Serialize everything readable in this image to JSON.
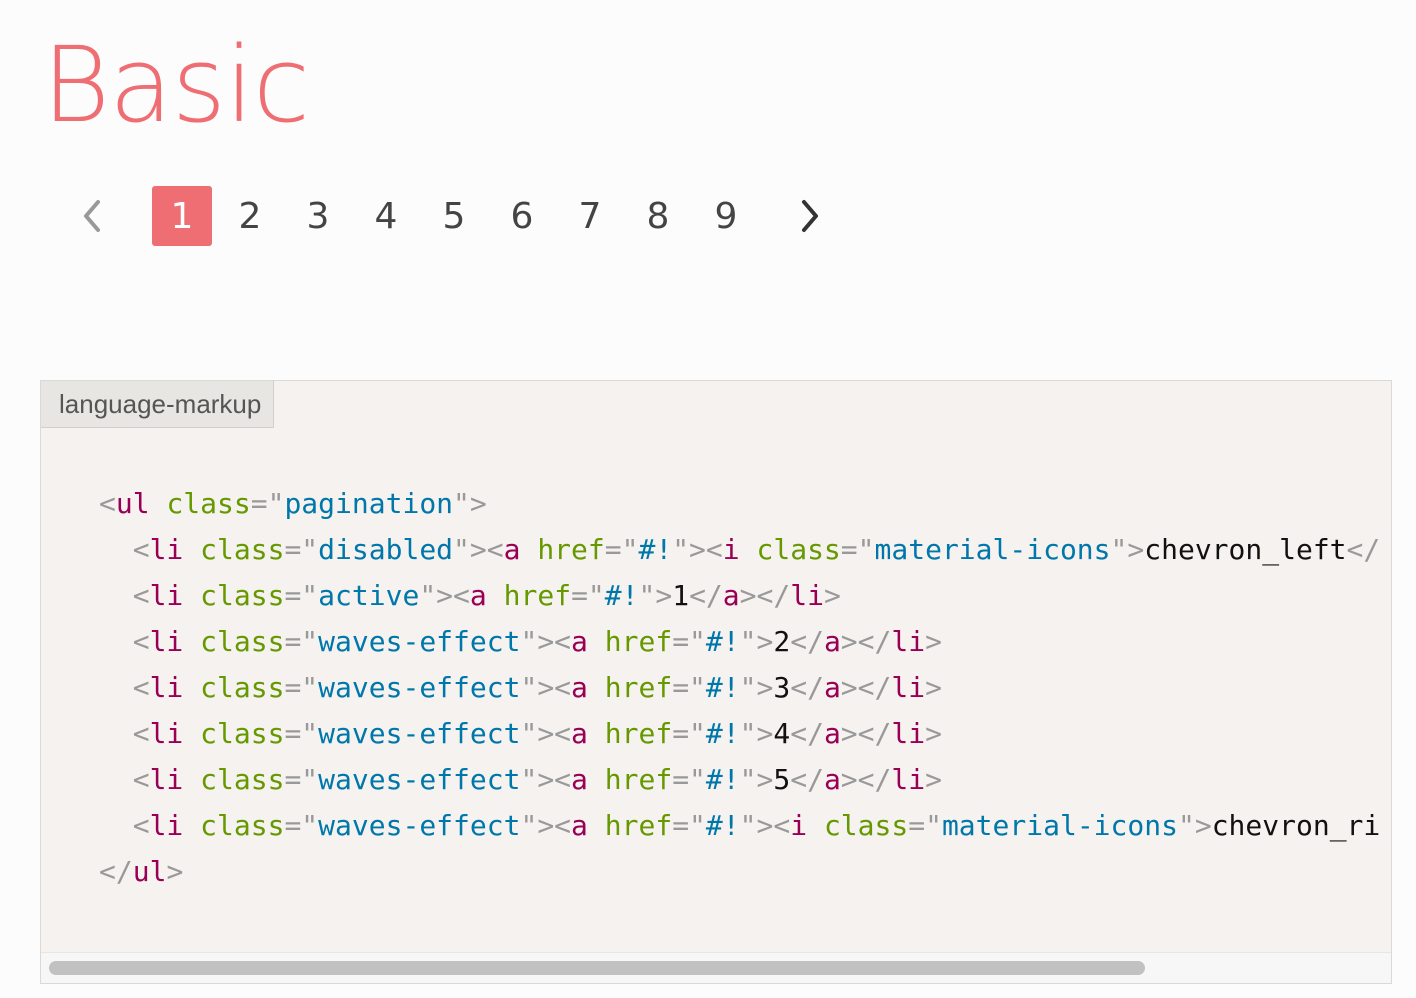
{
  "page": {
    "title": "Basic",
    "accent_color": "#ee6e73"
  },
  "pagination": {
    "prev_icon": "chevron-left-icon",
    "next_icon": "chevron-right-icon",
    "pages": [
      "1",
      "2",
      "3",
      "4",
      "5",
      "6",
      "7",
      "8",
      "9"
    ],
    "active_page": "1"
  },
  "code_block": {
    "language_label": "language-markup",
    "lines": {
      "l1": {
        "t1": "ul",
        "a1": "class",
        "v1": "pagination"
      },
      "l2": {
        "t1": "li",
        "a1": "class",
        "v1": "disabled",
        "t2": "a",
        "a2": "href",
        "v2": "#!",
        "t3": "i",
        "a3": "class",
        "v3": "material-icons",
        "text": "chevron_left"
      },
      "l3": {
        "t1": "li",
        "a1": "class",
        "v1": "active",
        "t2": "a",
        "a2": "href",
        "v2": "#!",
        "text": "1"
      },
      "l4": {
        "t1": "li",
        "a1": "class",
        "v1": "waves-effect",
        "t2": "a",
        "a2": "href",
        "v2": "#!",
        "text": "2"
      },
      "l5": {
        "t1": "li",
        "a1": "class",
        "v1": "waves-effect",
        "t2": "a",
        "a2": "href",
        "v2": "#!",
        "text": "3"
      },
      "l6": {
        "t1": "li",
        "a1": "class",
        "v1": "waves-effect",
        "t2": "a",
        "a2": "href",
        "v2": "#!",
        "text": "4"
      },
      "l7": {
        "t1": "li",
        "a1": "class",
        "v1": "waves-effect",
        "t2": "a",
        "a2": "href",
        "v2": "#!",
        "text": "5"
      },
      "l8": {
        "t1": "li",
        "a1": "class",
        "v1": "waves-effect",
        "t2": "a",
        "a2": "href",
        "v2": "#!",
        "t3": "i",
        "a3": "class",
        "v3": "material-icons",
        "text": "chevron_ri"
      },
      "l9": {
        "t1": "ul"
      }
    }
  }
}
